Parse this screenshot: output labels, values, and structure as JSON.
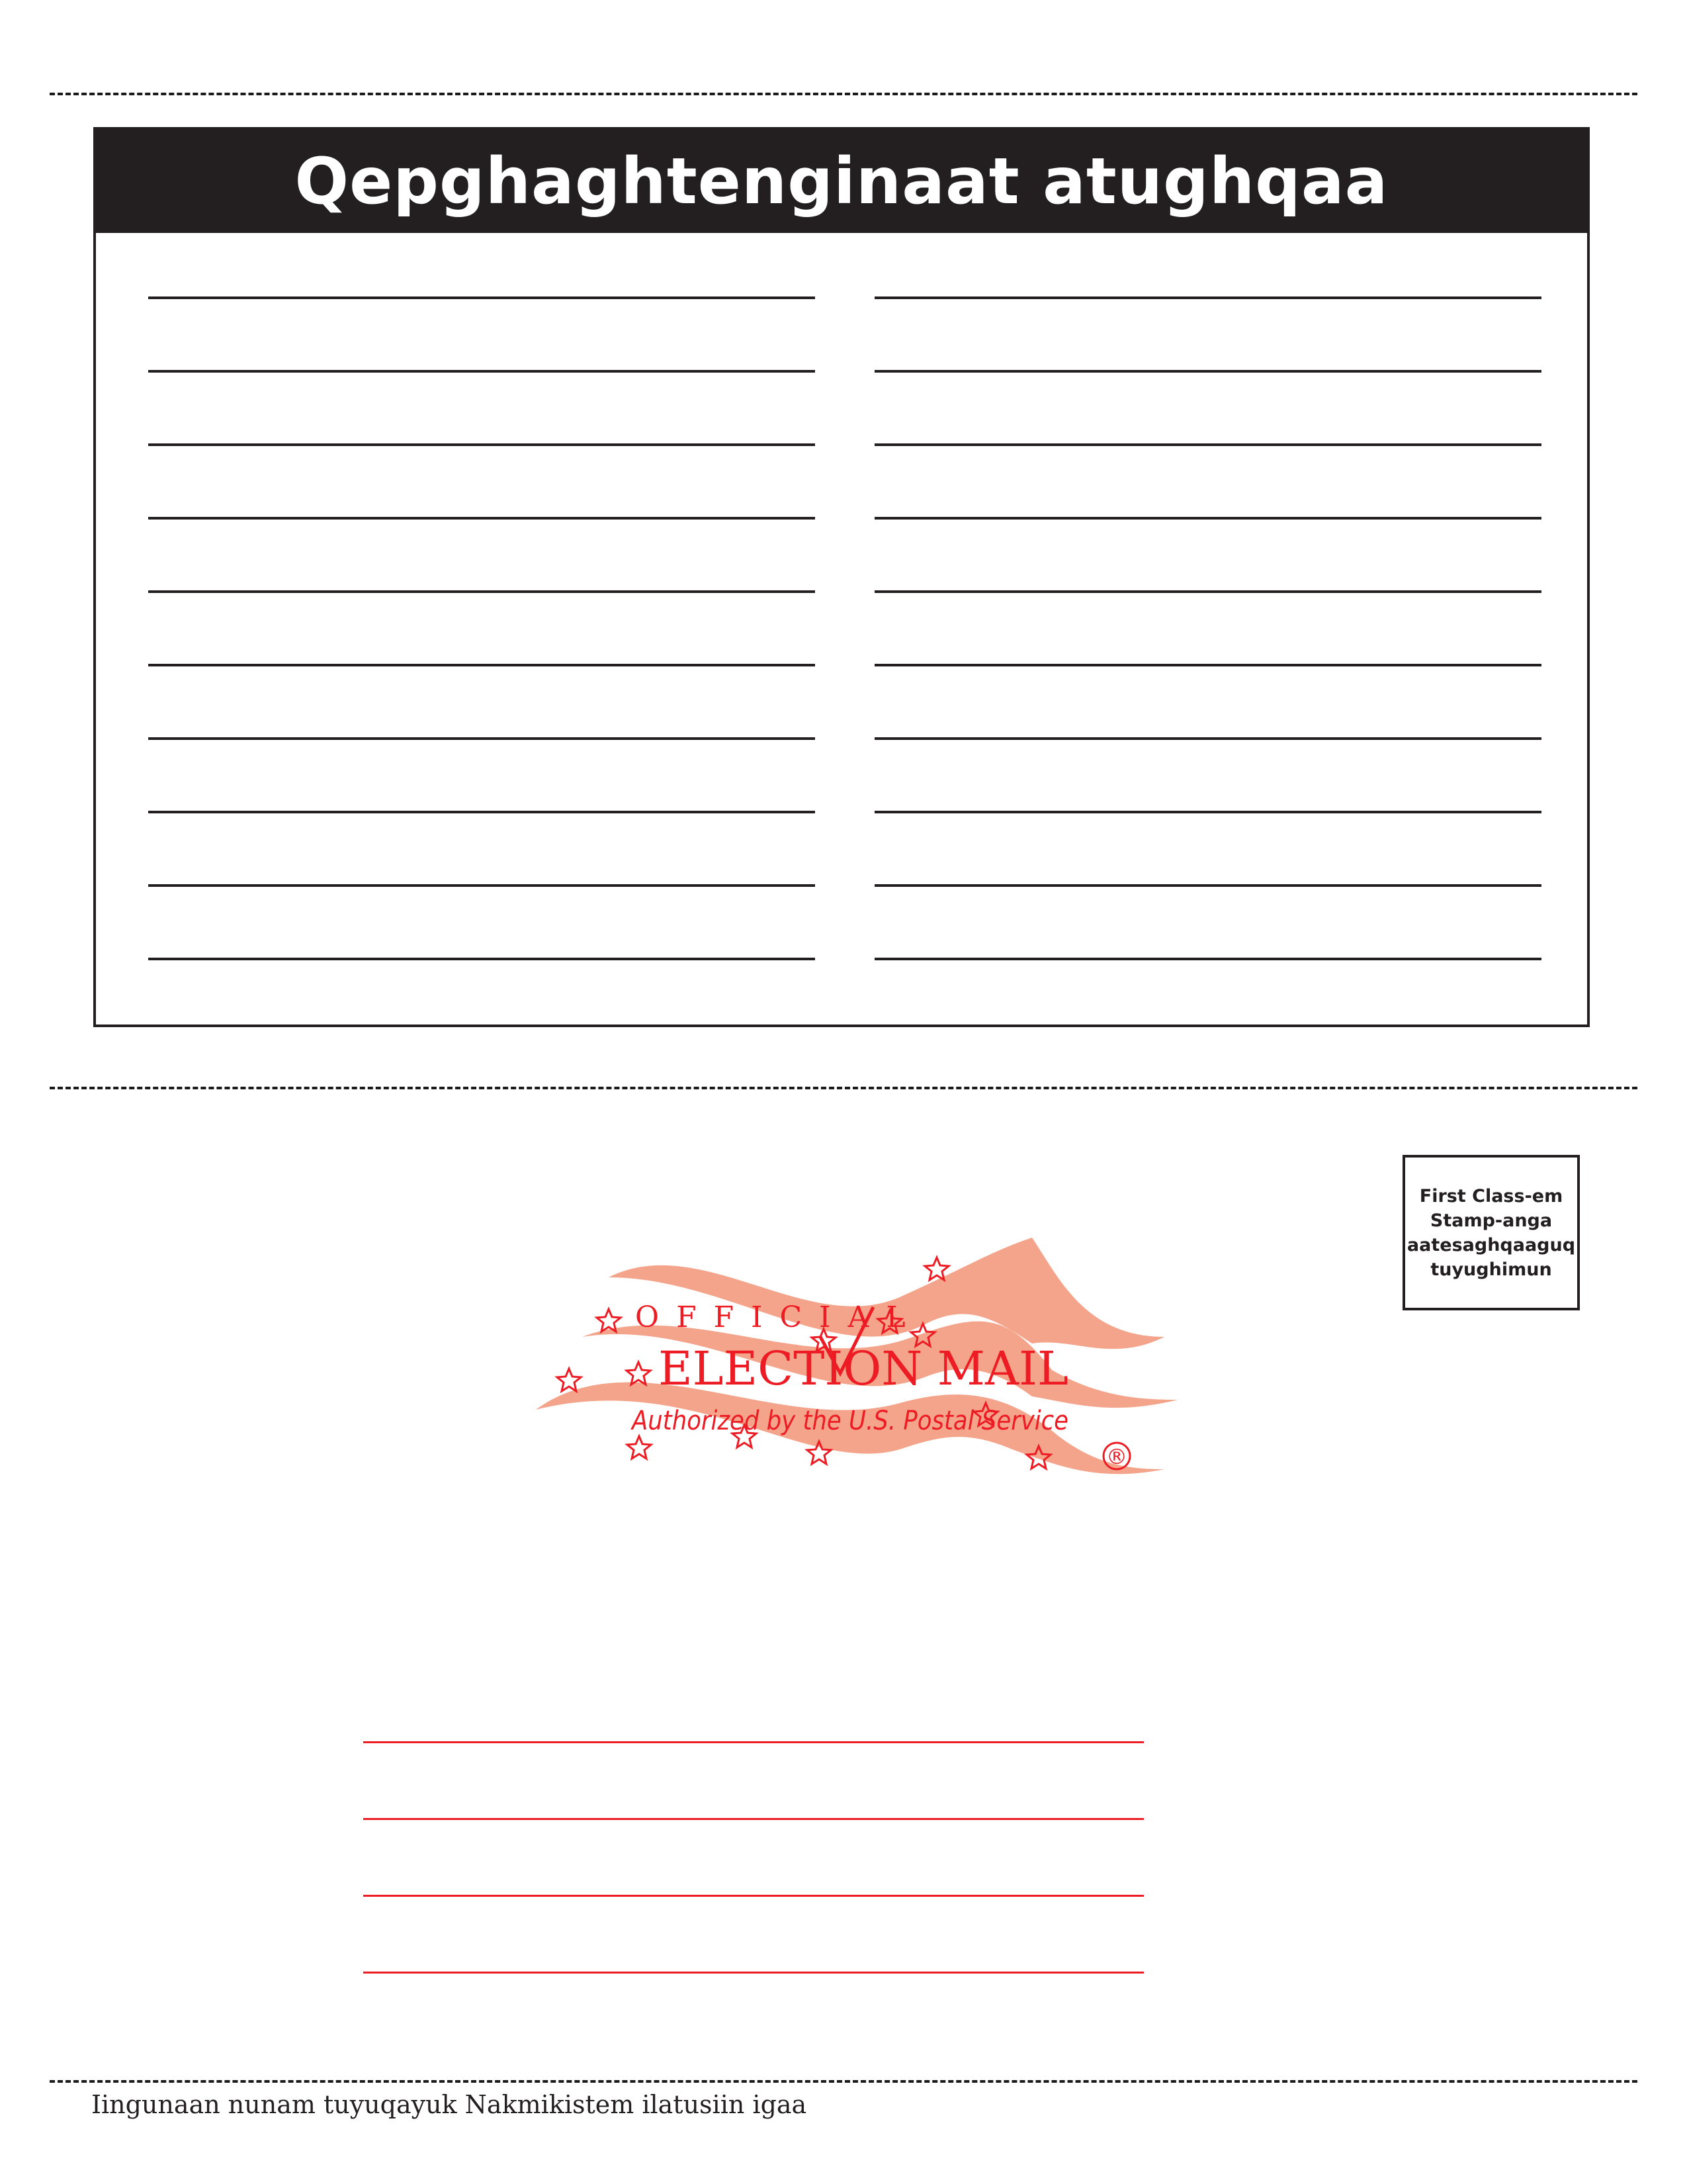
{
  "notes": {
    "title": "Qepghaghtenginaat atughqaa",
    "rows_per_column": 10,
    "columns": 2
  },
  "stamp": {
    "lines": [
      "First Class-em",
      "Stamp-anga",
      "aatesaghqaaguq",
      "tuyughimun"
    ]
  },
  "logo": {
    "top_text": "OFFICIAL",
    "main_text": "ELECTION MAIL",
    "sub_text": "Authorized by the U.S. Postal Service",
    "registered_mark": "®",
    "wave_color": "#f4a48a",
    "text_color": "#ed1c24"
  },
  "address": {
    "line_count": 4,
    "line_color": "#ed1c24"
  },
  "footer": {
    "text": "Iingunaan nunam tuyuqayuk Nakmikistem ilatusiin igaa"
  }
}
